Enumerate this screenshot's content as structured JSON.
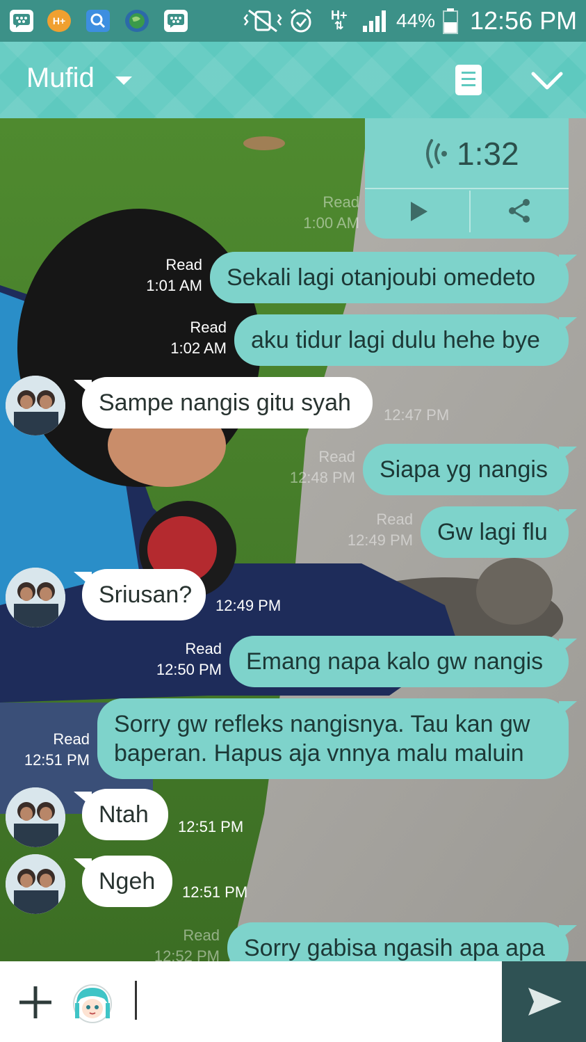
{
  "status_bar": {
    "network_type": "H+",
    "battery": "44%",
    "time": "12:56 PM",
    "notification_icons": [
      "bbm-icon",
      "hplus-icon",
      "search-app-icon",
      "globe-icon",
      "bbm-icon"
    ]
  },
  "header": {
    "contact_name": "Mufid"
  },
  "voice_message": {
    "duration": "1:32",
    "read_label": "Read",
    "time": "1:00 AM"
  },
  "messages": [
    {
      "side": "out",
      "text": "Sekali lagi otanjoubi omedeto",
      "read": "Read",
      "time": "1:01 AM"
    },
    {
      "side": "out",
      "text": "aku tidur lagi dulu hehe bye",
      "read": "Read",
      "time": "1:02 AM"
    },
    {
      "side": "in",
      "text": "Sampe nangis gitu syah",
      "time": "12:47 PM"
    },
    {
      "side": "out",
      "text": "Siapa yg nangis",
      "read": "Read",
      "time": "12:48 PM"
    },
    {
      "side": "out",
      "text": "Gw lagi flu",
      "read": "Read",
      "time": "12:49 PM"
    },
    {
      "side": "in",
      "text": "Sriusan?",
      "time": "12:49 PM"
    },
    {
      "side": "out",
      "text": "Emang napa kalo gw nangis",
      "read": "Read",
      "time": "12:50 PM"
    },
    {
      "side": "out",
      "text_line1": "Sorry gw refleks nangisnya. Tau kan gw",
      "text_line2": "baperan. Hapus aja vnnya malu maluin",
      "read": "Read",
      "time": "12:51 PM"
    },
    {
      "side": "in",
      "text": "Ntah",
      "time": "12:51 PM"
    },
    {
      "side": "in",
      "text": "Ngeh",
      "time": "12:51 PM"
    },
    {
      "side": "out",
      "text": "Sorry gabisa ngasih apa apa",
      "read": "Read",
      "time": "12:52 PM"
    }
  ],
  "input": {
    "placeholder": "",
    "value": ""
  },
  "colors": {
    "status_bar": "#3c9188",
    "header": "#5ec9bf",
    "bubble_out": "#7ed3cb",
    "bubble_in": "#ffffff",
    "send_button": "#2f5254"
  }
}
